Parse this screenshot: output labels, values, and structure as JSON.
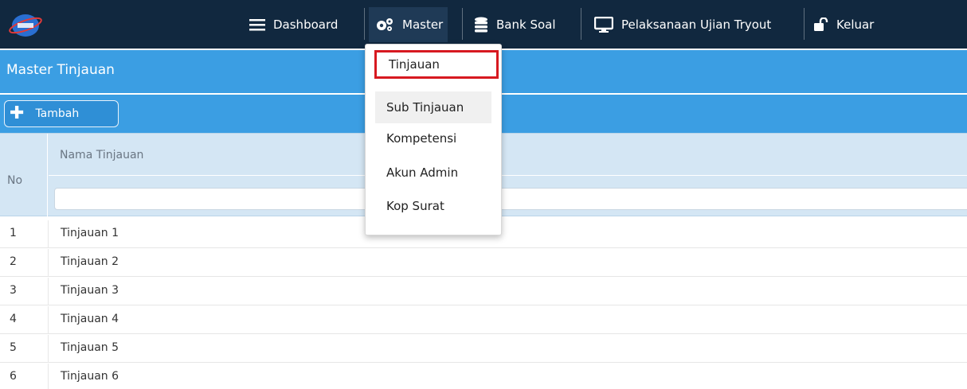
{
  "navbar": {
    "items": [
      {
        "label": "Dashboard",
        "icon": "menu-icon"
      },
      {
        "label": "Master",
        "icon": "gears-icon"
      },
      {
        "label": "Bank Soal",
        "icon": "database-icon"
      },
      {
        "label": "Pelaksanaan Ujian Tryout",
        "icon": "monitor-icon"
      },
      {
        "label": "Keluar",
        "icon": "unlock-icon"
      }
    ]
  },
  "page": {
    "title": "Master Tinjauan",
    "add_label": "Tambah"
  },
  "table": {
    "headers": {
      "no": "No",
      "name": "Nama Tinjauan"
    },
    "filter_value": "",
    "rows": [
      {
        "no": "1",
        "name": "Tinjauan 1"
      },
      {
        "no": "2",
        "name": "Tinjauan 2"
      },
      {
        "no": "3",
        "name": "Tinjauan 3"
      },
      {
        "no": "4",
        "name": "Tinjauan 4"
      },
      {
        "no": "5",
        "name": "Tinjauan 5"
      },
      {
        "no": "6",
        "name": "Tinjauan 6"
      }
    ]
  },
  "dropdown": {
    "items": [
      "Tinjauan",
      "Sub Tinjauan",
      "Kompetensi",
      "Akun Admin",
      "Kop Surat"
    ]
  },
  "colors": {
    "navbar_bg": "#11283f",
    "accent_blue": "#3b9ee3",
    "header_bg": "#d4e6f4",
    "highlight_red": "#d71920"
  }
}
